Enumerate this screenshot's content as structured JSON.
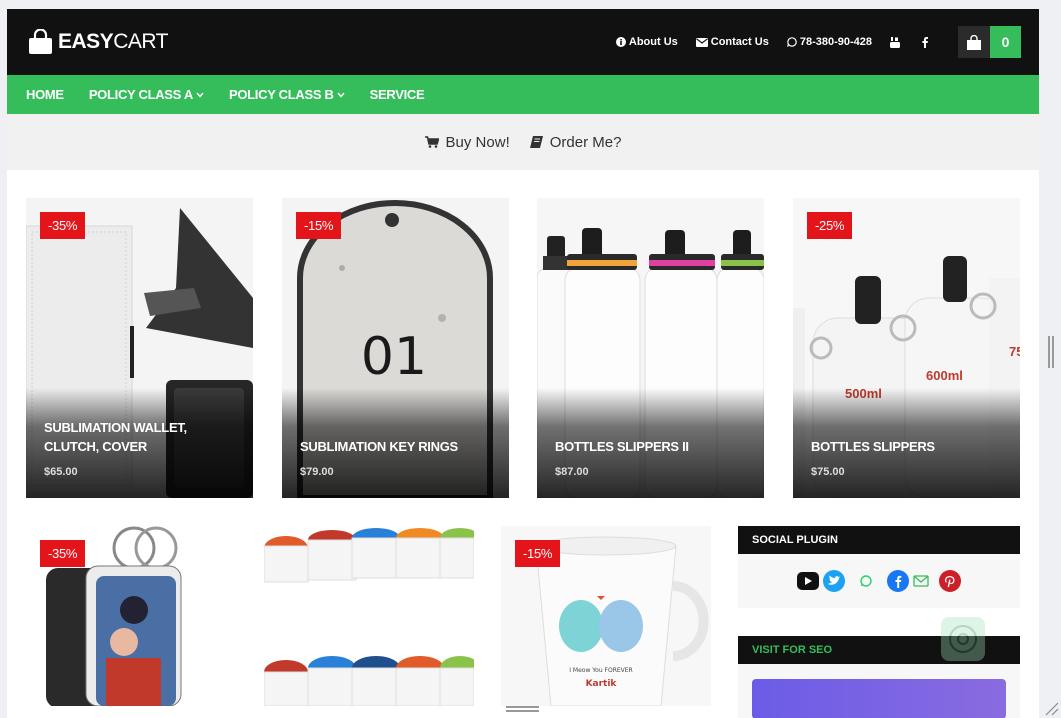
{
  "brand": {
    "name_bold": "EASY",
    "name_regular": "CART"
  },
  "toplinks": {
    "about": "About Us",
    "contact": "Contact Us",
    "phone": "78-380-90-428"
  },
  "cart": {
    "count": "0"
  },
  "nav": {
    "home": "HOME",
    "policy_a": "POLICY CLASS A",
    "policy_b": "POLICY CLASS B",
    "service": "SERVICE"
  },
  "subbar": {
    "buy": "Buy Now!",
    "order": "Order Me?"
  },
  "products": [
    {
      "title": "SUBLIMATION WALLET, CLUTCH, COVER",
      "price": "$65.00",
      "discount": "-35%"
    },
    {
      "title": "SUBLIMATION KEY RINGS",
      "price": "$79.00",
      "discount": "-15%",
      "tag_text": "01"
    },
    {
      "title": "BOTTLES SLIPPERS II",
      "price": "$87.00",
      "discount": ""
    },
    {
      "title": "BOTTLES SLIPPERS",
      "price": "$75.00",
      "discount": "-25%",
      "label_500": "500ml",
      "label_600": "600ml",
      "label_75": "75"
    }
  ],
  "products_row2": [
    {
      "discount": "-35%"
    },
    {
      "discount": ""
    },
    {
      "discount": "-15%",
      "mug_text1": "I Meow You FOREVER",
      "mug_text2": "Kartik"
    }
  ],
  "widgets": {
    "social": "SOCIAL PLUGIN",
    "seo": "VISIT FOR SEO"
  },
  "colors": {
    "accent": "#35bd5b",
    "dark": "#111111",
    "badge": "#e4141b"
  }
}
